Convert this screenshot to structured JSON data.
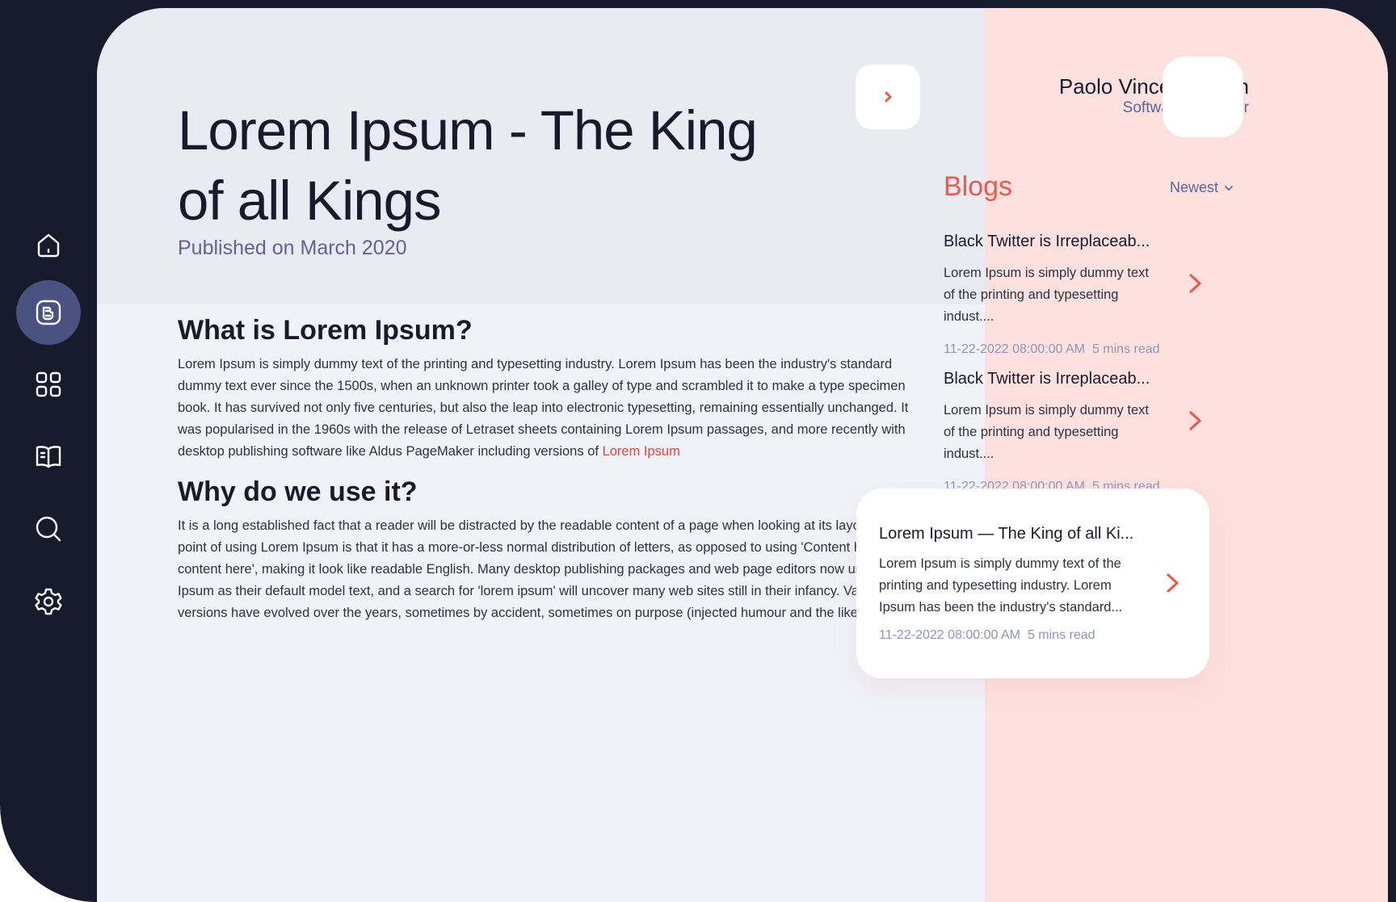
{
  "sidebar": {
    "items": [
      {
        "icon": "home-icon",
        "active": false
      },
      {
        "icon": "blog-icon",
        "active": true
      },
      {
        "icon": "grid-icon",
        "active": false
      },
      {
        "icon": "book-icon",
        "active": false
      },
      {
        "icon": "search-icon",
        "active": false
      },
      {
        "icon": "settings-icon",
        "active": false
      }
    ]
  },
  "article": {
    "title": "Lorem Ipsum - The King of all Kings",
    "published": "Published on March 2020",
    "section1_heading": "What is Lorem Ipsum?",
    "section1_text": "Lorem Ipsum is simply dummy text of the printing and typesetting industry. Lorem Ipsum has been the industry's standard dummy text ever since the 1500s, when an unknown printer took a galley of type and scrambled it to make a type specimen book. It has survived not only five centuries, but also the leap into electronic typesetting, remaining essentially unchanged. It was popularised in the 1960s with the release of Letraset sheets containing Lorem Ipsum passages, and more recently with desktop publishing software like Aldus PageMaker including versions of",
    "section1_link": "Lorem Ipsum",
    "section2_heading": "Why do we use it?",
    "section2_text": "It is a long established fact that a reader will be distracted by the readable content of a page when looking at its layout. The point of using Lorem Ipsum is that it has a more-or-less normal distribution of letters, as opposed to using 'Content here, content here', making it look like readable English. Many desktop publishing packages and web page editors now use Lorem Ipsum as their default model text, and a search for 'lorem ipsum' will uncover many web sites still in their infancy. Various versions have evolved over the years, sometimes by accident, sometimes on purpose (injected humour and the like)."
  },
  "profile": {
    "name": "Paolo Vincent Julian",
    "role": "Software Engineer"
  },
  "blogs": {
    "title": "Blogs",
    "sort_label": "Newest",
    "items": [
      {
        "title": "Black Twitter is Irreplaceab...",
        "excerpt": "Lorem Ipsum is simply dummy text of the printing and typesetting indust....",
        "date": "11-22-2022 08:00:00 AM",
        "read_time": "5 mins read"
      },
      {
        "title": "Black Twitter is Irreplaceab...",
        "excerpt": "Lorem Ipsum is simply dummy text of the printing and typesetting indust....",
        "date": "11-22-2022 08:00:00 AM",
        "read_time": "5 mins read"
      },
      {
        "title": "Lorem Ipsum — The King of all Ki...",
        "excerpt": "Lorem Ipsum is simply dummy text of the printing and typesetting industry. Lorem Ipsum has been the industry's standard...",
        "date": "11-22-2022 08:00:00 AM",
        "read_time": "5 mins read",
        "selected": true
      }
    ]
  },
  "colors": {
    "dark": "#181b2b",
    "accent": "#ea5a50",
    "muted": "#5c6596",
    "right_panel_bg": "#fde1df",
    "active_nav": "#4a5282"
  }
}
